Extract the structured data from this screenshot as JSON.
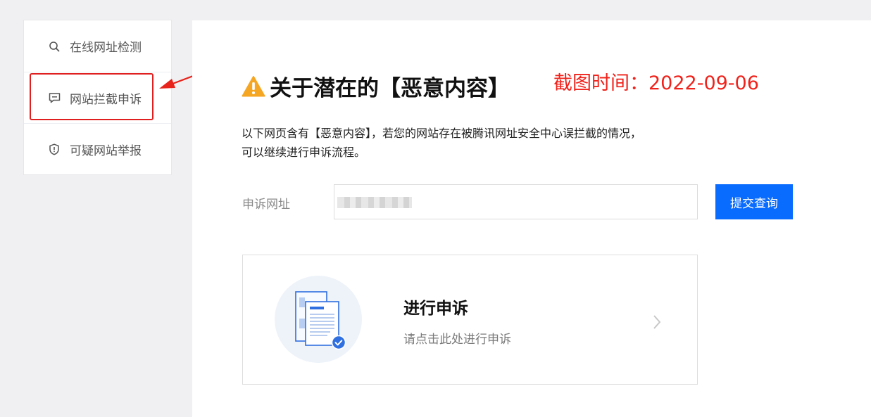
{
  "sidebar": {
    "items": [
      {
        "label": "在线网址检测",
        "icon": "search-icon"
      },
      {
        "label": "网站拦截申诉",
        "icon": "message-icon"
      },
      {
        "label": "可疑网站举报",
        "icon": "shield-icon"
      }
    ]
  },
  "main": {
    "title": "关于潜在的【恶意内容】",
    "capture_time": "截图时间：2022-09-06",
    "description_line1": "以下网页含有【恶意内容】，若您的网站存在被腾讯网址安全中心误拦截的情况，",
    "description_line2": "可以继续进行申诉流程。",
    "form": {
      "label": "申诉网址",
      "input_value": "",
      "submit_label": "提交查询"
    },
    "appeal_card": {
      "title": "进行申诉",
      "subtitle": "请点击此处进行申诉"
    }
  },
  "colors": {
    "accent": "#0a6cff",
    "annotation_red": "#f0221b",
    "warning": "#f5a623"
  }
}
